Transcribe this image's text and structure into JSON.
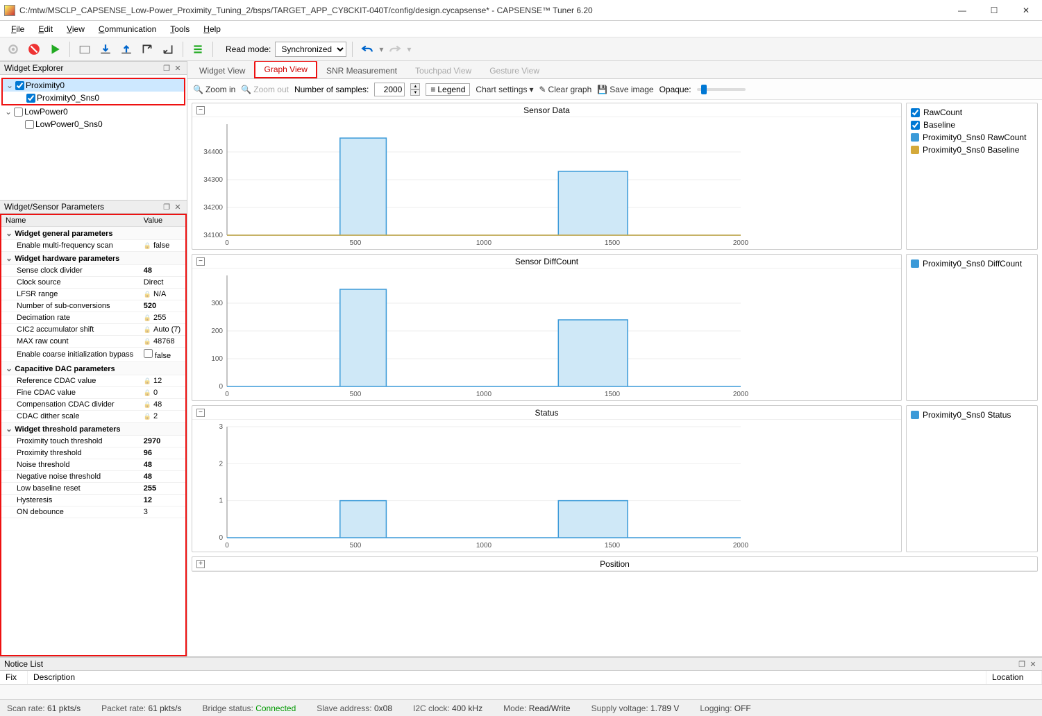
{
  "window": {
    "title": "C:/mtw/MSCLP_CAPSENSE_Low-Power_Proximity_Tuning_2/bsps/TARGET_APP_CY8CKIT-040T/config/design.cycapsense* - CAPSENSE™ Tuner 6.20"
  },
  "menu": {
    "items": [
      "File",
      "Edit",
      "View",
      "Communication",
      "Tools",
      "Help"
    ]
  },
  "toolbar": {
    "read_mode_label": "Read mode:",
    "read_mode_value": "Synchronized"
  },
  "explorer": {
    "title": "Widget Explorer",
    "items": [
      {
        "name": "Proximity0",
        "checked": true,
        "selected": true,
        "children": [
          {
            "name": "Proximity0_Sns0",
            "checked": true
          }
        ]
      },
      {
        "name": "LowPower0",
        "checked": false,
        "children": [
          {
            "name": "LowPower0_Sns0",
            "checked": false
          }
        ]
      }
    ]
  },
  "params": {
    "title": "Widget/Sensor Parameters",
    "cols": [
      "Name",
      "Value"
    ],
    "groups": [
      {
        "name": "Widget general parameters",
        "rows": [
          {
            "n": "Enable multi-frequency scan",
            "v": "false",
            "lock": true
          }
        ]
      },
      {
        "name": "Widget hardware parameters",
        "rows": [
          {
            "n": "Sense clock divider",
            "v": "48",
            "bold": true
          },
          {
            "n": "Clock source",
            "v": "Direct"
          },
          {
            "n": "LFSR range",
            "v": "N/A",
            "lock": true
          },
          {
            "n": "Number of sub-conversions",
            "v": "520",
            "bold": true
          },
          {
            "n": "Decimation rate",
            "v": "255",
            "lock": true
          },
          {
            "n": "CIC2 accumulator shift",
            "v": "Auto (7)",
            "lock": true
          },
          {
            "n": "MAX raw count",
            "v": "48768",
            "lock": true
          },
          {
            "n": "Enable coarse initialization bypass",
            "v": "false",
            "cb": true
          }
        ]
      },
      {
        "name": "Capacitive DAC parameters",
        "rows": [
          {
            "n": "Reference CDAC value",
            "v": "12",
            "lock": true
          },
          {
            "n": "Fine CDAC value",
            "v": "0",
            "lock": true
          },
          {
            "n": "Compensation CDAC divider",
            "v": "48",
            "lock": true
          },
          {
            "n": "CDAC dither scale",
            "v": "2",
            "lock": true
          }
        ]
      },
      {
        "name": "Widget threshold parameters",
        "rows": [
          {
            "n": "Proximity touch threshold",
            "v": "2970",
            "bold": true
          },
          {
            "n": "Proximity threshold",
            "v": "96",
            "bold": true
          },
          {
            "n": "Noise threshold",
            "v": "48",
            "bold": true
          },
          {
            "n": "Negative noise threshold",
            "v": "48",
            "bold": true
          },
          {
            "n": "Low baseline reset",
            "v": "255",
            "bold": true
          },
          {
            "n": "Hysteresis",
            "v": "12",
            "bold": true
          },
          {
            "n": "ON debounce",
            "v": "3"
          }
        ]
      }
    ]
  },
  "tabs": [
    "Widget View",
    "Graph View",
    "SNR Measurement",
    "Touchpad View",
    "Gesture View"
  ],
  "graph_toolbar": {
    "zoom_in": "Zoom in",
    "zoom_out": "Zoom out",
    "num_samples_label": "Number of samples:",
    "num_samples": "2000",
    "legend": "Legend",
    "chart_settings": "Chart settings",
    "clear": "Clear graph",
    "save": "Save image",
    "opaque": "Opaque:"
  },
  "charts": {
    "sensor_data": {
      "title": "Sensor Data",
      "legend": [
        {
          "type": "check",
          "label": "RawCount",
          "color": "#3b9ad8"
        },
        {
          "type": "check",
          "label": "Baseline",
          "color": "#3b9ad8"
        },
        {
          "type": "swatch",
          "label": "Proximity0_Sns0 RawCount",
          "color": "#3b9ad8"
        },
        {
          "type": "swatch",
          "label": "Proximity0_Sns0 Baseline",
          "color": "#d4a93a"
        }
      ]
    },
    "diffcount": {
      "title": "Sensor DiffCount",
      "legend": [
        {
          "type": "swatch",
          "label": "Proximity0_Sns0 DiffCount",
          "color": "#3b9ad8"
        }
      ]
    },
    "status": {
      "title": "Status",
      "legend": [
        {
          "type": "swatch",
          "label": "Proximity0_Sns0 Status",
          "color": "#3b9ad8"
        }
      ]
    },
    "position": {
      "title": "Position"
    }
  },
  "chart_data": [
    {
      "type": "line",
      "title": "Sensor Data",
      "xlim": [
        0,
        2000
      ],
      "ylim": [
        34100,
        34500
      ],
      "yticks": [
        34100,
        34200,
        34300,
        34400
      ],
      "xticks": [
        0,
        500,
        1000,
        1500,
        2000
      ],
      "series": [
        {
          "name": "Proximity0_Sns0 RawCount",
          "pulses": [
            {
              "x0": 440,
              "x1": 620,
              "low": 34100,
              "high": 34450
            },
            {
              "x0": 1290,
              "x1": 1560,
              "low": 34100,
              "high": 34330
            }
          ]
        },
        {
          "name": "Proximity0_Sns0 Baseline",
          "constant": 34100
        }
      ]
    },
    {
      "type": "line",
      "title": "Sensor DiffCount",
      "xlim": [
        0,
        2000
      ],
      "ylim": [
        0,
        400
      ],
      "yticks": [
        0,
        100,
        200,
        300
      ],
      "xticks": [
        0,
        500,
        1000,
        1500,
        2000
      ],
      "series": [
        {
          "name": "Proximity0_Sns0 DiffCount",
          "pulses": [
            {
              "x0": 440,
              "x1": 620,
              "low": 0,
              "high": 350
            },
            {
              "x0": 1290,
              "x1": 1560,
              "low": 0,
              "high": 240
            }
          ]
        }
      ]
    },
    {
      "type": "line",
      "title": "Status",
      "xlim": [
        0,
        2000
      ],
      "ylim": [
        0,
        3
      ],
      "yticks": [
        0,
        1,
        2,
        3
      ],
      "xticks": [
        0,
        500,
        1000,
        1500,
        2000
      ],
      "series": [
        {
          "name": "Proximity0_Sns0 Status",
          "pulses": [
            {
              "x0": 440,
              "x1": 620,
              "low": 0,
              "high": 1
            },
            {
              "x0": 1290,
              "x1": 1560,
              "low": 0,
              "high": 1
            }
          ]
        }
      ]
    }
  ],
  "notice": {
    "title": "Notice List",
    "cols": [
      "Fix",
      "Description",
      "Location"
    ]
  },
  "status": {
    "scan_rate_label": "Scan rate:",
    "scan_rate": "61 pkts/s",
    "packet_rate_label": "Packet rate:",
    "packet_rate": "61 pkts/s",
    "bridge_label": "Bridge status:",
    "bridge": "Connected",
    "slave_label": "Slave address:",
    "slave": "0x08",
    "i2c_label": "I2C clock:",
    "i2c": "400 kHz",
    "mode_label": "Mode:",
    "mode": "Read/Write",
    "supply_label": "Supply voltage:",
    "supply": "1.789 V",
    "log_label": "Logging:",
    "log": "OFF"
  }
}
